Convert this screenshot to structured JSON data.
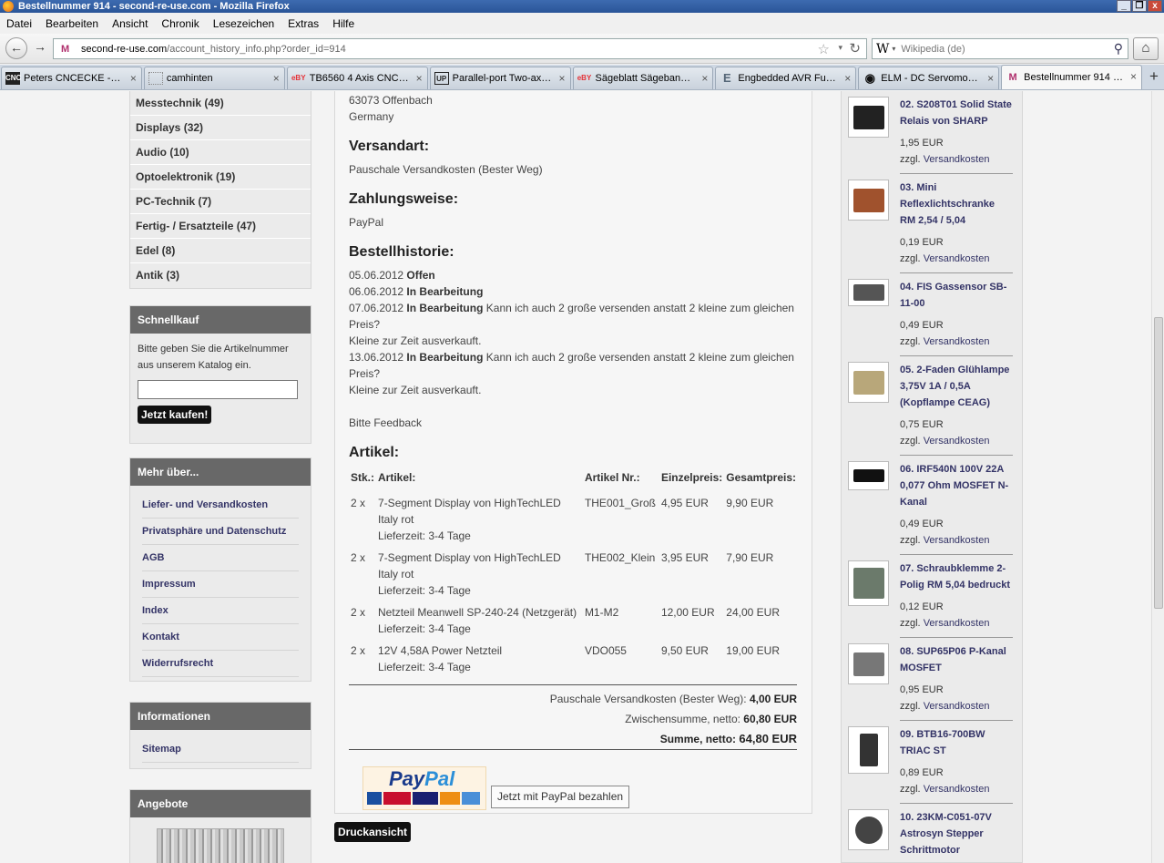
{
  "window": {
    "title": "Bestellnummer 914 - second-re-use.com - Mozilla Firefox",
    "minimize": "_",
    "maximize": "❐",
    "close": "x"
  },
  "menu": [
    "Datei",
    "Bearbeiten",
    "Ansicht",
    "Chronik",
    "Lesezeichen",
    "Extras",
    "Hilfe"
  ],
  "nav": {
    "back": "←",
    "forward": "→",
    "url_host": "second-re-use.com",
    "url_path": "/account_history_info.php?order_id=914",
    "star": "☆",
    "dropdown": "▾",
    "reload": "↻",
    "search_placeholder": "Wikipedia (de)",
    "search_engine_icon": "W",
    "search_caret": "▾",
    "search_icon": "⚲",
    "home": "⌂"
  },
  "tabs": [
    {
      "label": "Peters CNCECKE - Su...",
      "icon": "CNC",
      "icon_color": "#222222"
    },
    {
      "label": "camhinten",
      "icon": "",
      "icon_color": "#ffffff"
    },
    {
      "label": "TB6560 4 Axis CNC S...",
      "icon": "eBY",
      "icon_color": "#e53238"
    },
    {
      "label": "Parallel-port Two-axis...",
      "icon": "UP",
      "icon_color": "#222222"
    },
    {
      "label": "Sägeblatt Sägeband ...",
      "icon": "eBY",
      "icon_color": "#e53238"
    },
    {
      "label": "Engbedded AVR Fuse...",
      "icon": "E",
      "icon_color": "#556677"
    },
    {
      "label": "ELM - DC Servomotor...",
      "icon": "◉",
      "icon_color": "#111111"
    },
    {
      "label": "Bestellnummer 914 - ...",
      "icon": "M",
      "icon_color": "#b0306d",
      "active": true
    }
  ],
  "tab_close": "×",
  "new_tab": "+",
  "categories": [
    "Messtechnik (49)",
    "Displays (32)",
    "Audio (10)",
    "Optoelektronik (19)",
    "PC-Technik (7)",
    "Fertig- / Ersatzteile (47)",
    "Edel (8)",
    "Antik (3)"
  ],
  "quickbuy": {
    "title": "Schnellkauf",
    "text": "Bitte geben Sie die Artikelnummer aus unserem Katalog ein.",
    "button": "Jetzt kaufen!"
  },
  "more": {
    "title": "Mehr über...",
    "links": [
      "Liefer- und Versandkosten",
      "Privatsphäre und Datenschutz",
      "AGB",
      "Impressum",
      "Index",
      "Kontakt",
      "Widerrufsrecht"
    ]
  },
  "info": {
    "title": "Informationen",
    "links": [
      "Sitemap"
    ]
  },
  "offers": {
    "title": "Angebote"
  },
  "order": {
    "address_line1": "63073 Offenbach",
    "address_line2": "Germany",
    "shipping_heading": "Versandart:",
    "shipping_value": "Pauschale Versandkosten (Bester Weg)",
    "payment_heading": "Zahlungsweise:",
    "payment_value": "PayPal",
    "history_heading": "Bestellhistorie:",
    "history": [
      {
        "date": "05.06.2012",
        "status": "Offen",
        "comment": ""
      },
      {
        "date": "06.06.2012",
        "status": "In Bearbeitung",
        "comment": ""
      },
      {
        "date": "07.06.2012",
        "status": "In Bearbeitung",
        "comment": "Kann ich auch 2 große versenden anstatt 2 kleine zum gleichen Preis?",
        "reply": "Kleine zur Zeit ausverkauft."
      },
      {
        "date": "13.06.2012",
        "status": "In Bearbeitung",
        "comment": "Kann ich auch 2 große versenden anstatt 2 kleine zum gleichen Preis?",
        "reply": "Kleine zur Zeit ausverkauft."
      }
    ],
    "feedback": "Bitte Feedback",
    "items_heading": "Artikel:",
    "columns": {
      "qty": "Stk.:",
      "article": "Artikel:",
      "number": "Artikel Nr.:",
      "unit": "Einzelpreis:",
      "total": "Gesamtpreis:"
    },
    "items": [
      {
        "qty": "2 x",
        "name": "7-Segment Display von HighTechLED Italy rot",
        "delivery": "Lieferzeit: 3-4 Tage",
        "number": "THE001_Groß",
        "unit": "4,95 EUR",
        "total": "9,90 EUR"
      },
      {
        "qty": "2 x",
        "name": "7-Segment Display von HighTechLED Italy rot",
        "delivery": "Lieferzeit: 3-4 Tage",
        "number": "THE002_Klein",
        "unit": "3,95 EUR",
        "total": "7,90 EUR"
      },
      {
        "qty": "2 x",
        "name": "Netzteil Meanwell SP-240-24 (Netzgerät)",
        "delivery": "Lieferzeit: 3-4 Tage",
        "number": "M1-M2",
        "unit": "12,00 EUR",
        "total": "24,00 EUR"
      },
      {
        "qty": "2 x",
        "name": "12V 4,58A Power Netzteil",
        "delivery": "Lieferzeit: 3-4 Tage",
        "number": "VDO055",
        "unit": "9,50 EUR",
        "total": "19,00 EUR"
      }
    ],
    "totals": {
      "shipping_label": "Pauschale Versandkosten (Bester Weg):",
      "shipping_value": "4,00 EUR",
      "subtotal_label": "Zwischensumme, netto:",
      "subtotal_value": "60,80 EUR",
      "sum_label": "Summe, netto:",
      "sum_value": "64,80 EUR"
    },
    "paypal_logo_a": "Pay",
    "paypal_logo_b": "Pal",
    "paypal_button": "Jetzt mit PayPal bezahlen",
    "print_button": "Druckansicht"
  },
  "products": [
    {
      "name": "02. S208T01 Solid State Relais von SHARP",
      "price": "1,95 EUR",
      "ship_prefix": "zzgl.",
      "ship_link": "Versandkosten",
      "color": "#222222"
    },
    {
      "name": "03. Mini Reflexlichtschranke RM 2,54 / 5,04",
      "price": "0,19 EUR",
      "ship_prefix": "zzgl.",
      "ship_link": "Versandkosten",
      "color": "#a0522d"
    },
    {
      "name": "04. FIS Gassensor SB-11-00",
      "price": "0,49 EUR",
      "ship_prefix": "zzgl.",
      "ship_link": "Versandkosten",
      "color": "#555555"
    },
    {
      "name": "05. 2-Faden Glühlampe 3,75V 1A / 0,5A (Kopflampe CEAG)",
      "price": "0,75 EUR",
      "ship_prefix": "zzgl.",
      "ship_link": "Versandkosten",
      "color": "#b8a77a"
    },
    {
      "name": "06. IRF540N 100V 22A 0,077 Ohm MOSFET N-Kanal",
      "price": "0,49 EUR",
      "ship_prefix": "zzgl.",
      "ship_link": "Versandkosten",
      "color": "#111111"
    },
    {
      "name": "07. Schraubklemme 2-Polig RM 5,04 bedruckt",
      "price": "0,12 EUR",
      "ship_prefix": "zzgl.",
      "ship_link": "Versandkosten",
      "color": "#6b7a6b"
    },
    {
      "name": "08. SUP65P06 P-Kanal MOSFET",
      "price": "0,95 EUR",
      "ship_prefix": "zzgl.",
      "ship_link": "Versandkosten",
      "color": "#777777"
    },
    {
      "name": "09. BTB16-700BW TRIAC ST",
      "price": "0,89 EUR",
      "ship_prefix": "zzgl.",
      "ship_link": "Versandkosten",
      "color": "#333333"
    },
    {
      "name": "10. 23KM-C051-07V Astrosyn Stepper Schrittmotor",
      "price": "",
      "ship_prefix": "",
      "ship_link": "",
      "color": "#444444"
    }
  ]
}
